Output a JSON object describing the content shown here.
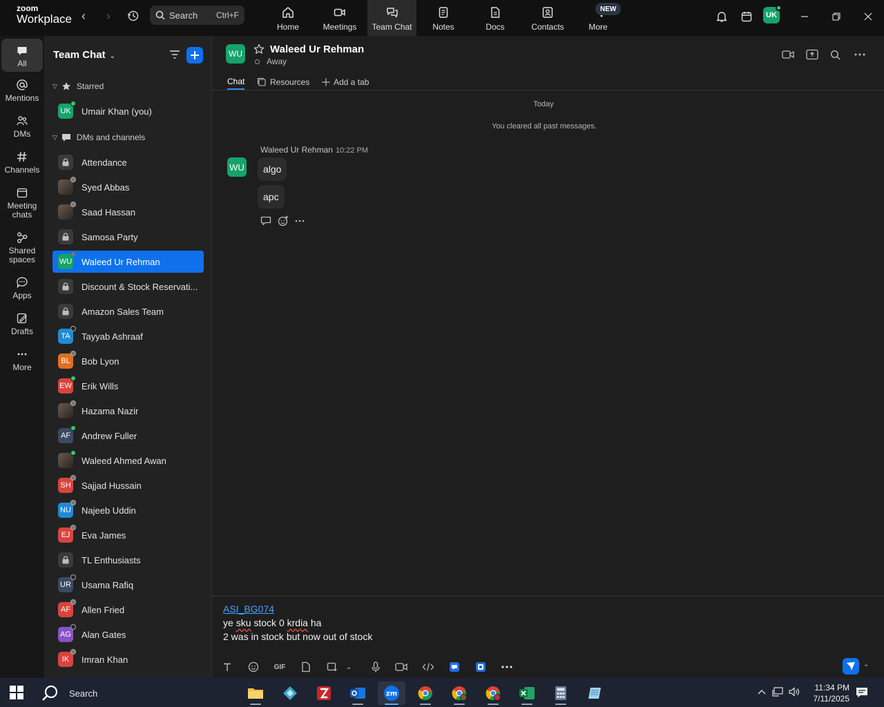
{
  "app": {
    "logo_line1": "zoom",
    "logo_line2": "Workplace"
  },
  "topbar": {
    "search_label": "Search",
    "search_shortcut": "Ctrl+F",
    "user_initials": "UK",
    "tabs": [
      {
        "label": "Home"
      },
      {
        "label": "Meetings"
      },
      {
        "label": "Team Chat"
      },
      {
        "label": "Notes"
      },
      {
        "label": "Docs"
      },
      {
        "label": "Contacts"
      },
      {
        "label": "More"
      }
    ],
    "new_badge": "NEW"
  },
  "rail": {
    "items": [
      {
        "label": "All"
      },
      {
        "label": "Mentions"
      },
      {
        "label": "DMs"
      },
      {
        "label": "Channels"
      },
      {
        "label": "Meeting chats"
      },
      {
        "label": "Shared spaces"
      },
      {
        "label": "Apps"
      },
      {
        "label": "Drafts"
      },
      {
        "label": "More"
      }
    ]
  },
  "panel": {
    "title": "Team Chat",
    "starred_label": "Starred",
    "dms_label": "DMs and channels",
    "starred": [
      {
        "label": "Umair Khan (you)",
        "initials": "UK",
        "color": "#17a36b",
        "status": "online"
      }
    ],
    "items": [
      {
        "label": "Attendance",
        "kind": "channel"
      },
      {
        "label": "Syed Abbas",
        "kind": "photo",
        "status": "away"
      },
      {
        "label": "Saad Hassan",
        "kind": "photo",
        "status": "away"
      },
      {
        "label": "Samosa Party",
        "kind": "channel"
      },
      {
        "label": "Waleed Ur Rehman",
        "initials": "WU",
        "color": "#17a36b",
        "status": "away",
        "selected": true
      },
      {
        "label": "Discount & Stock Reservati...",
        "kind": "channel"
      },
      {
        "label": "Amazon Sales Team",
        "kind": "channel"
      },
      {
        "label": "Tayyab Ashraaf",
        "initials": "TA",
        "color": "#1f8ad6",
        "status": "off"
      },
      {
        "label": "Bob Lyon",
        "initials": "BL",
        "color": "#e0701e",
        "status": "away"
      },
      {
        "label": "Erik Wills",
        "initials": "EW",
        "color": "#d9443b",
        "status": "online"
      },
      {
        "label": "Hazama Nazir",
        "kind": "photo",
        "status": "away"
      },
      {
        "label": "Andrew Fuller",
        "initials": "AF",
        "color": "#3b4a63",
        "status": "online"
      },
      {
        "label": "Waleed Ahmed Awan",
        "kind": "photo",
        "status": "online"
      },
      {
        "label": "Sajjad Hussain",
        "initials": "SH",
        "color": "#d9443b",
        "status": "away"
      },
      {
        "label": "Najeeb Uddin",
        "initials": "NU",
        "color": "#1f8ad6",
        "status": "away"
      },
      {
        "label": "Eva James",
        "initials": "EJ",
        "color": "#d9443b",
        "status": "away"
      },
      {
        "label": "TL Enthusiasts",
        "kind": "channel"
      },
      {
        "label": "Usama Rafiq",
        "initials": "UR",
        "color": "#3b4a63",
        "status": "off"
      },
      {
        "label": "Allen Fried",
        "initials": "AF",
        "color": "#d9443b",
        "status": "away"
      },
      {
        "label": "Alan Gates",
        "initials": "AG",
        "color": "#8b52c8",
        "status": "off"
      },
      {
        "label": "Imran Khan",
        "initials": "IK",
        "color": "#d9443b",
        "status": "away"
      }
    ]
  },
  "chat": {
    "contact_name": "Waleed Ur Rehman",
    "contact_initials": "WU",
    "contact_status": "Away",
    "tabs": [
      {
        "label": "Chat"
      },
      {
        "label": "Resources"
      },
      {
        "label": "Add a tab"
      }
    ],
    "date_separator": "Today",
    "cleared_notice": "You cleared all past messages.",
    "message": {
      "sender": "Waleed Ur Rehman",
      "time": "10:22 PM",
      "bubbles": [
        "algo",
        "apc"
      ]
    }
  },
  "composer": {
    "link_text": "ASI_BG074",
    "line2_a": "ye ",
    "line2_b": "sku",
    "line2_c": " stock 0 ",
    "line2_d": "krdia",
    "line2_e": " ha",
    "line3": "2 was in stock but now out of stock",
    "gif_label": "GIF"
  },
  "taskbar": {
    "search_label": "Search",
    "time": "11:34 PM",
    "date": "7/11/2025"
  }
}
